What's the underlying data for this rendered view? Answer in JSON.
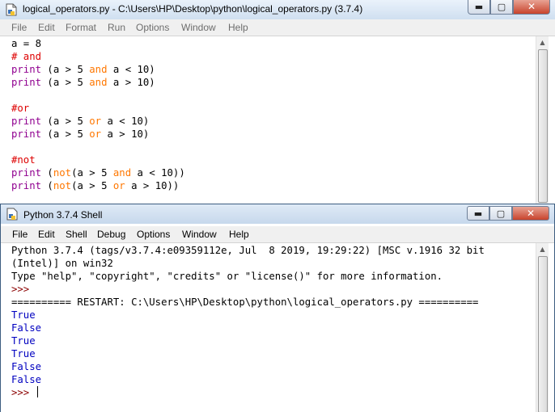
{
  "editor": {
    "title": "logical_operators.py - C:\\Users\\HP\\Desktop\\python\\logical_operators.py (3.7.4)",
    "menu": [
      "File",
      "Edit",
      "Format",
      "Run",
      "Options",
      "Window",
      "Help"
    ],
    "lines": [
      [
        {
          "t": "a = 8",
          "c": ""
        }
      ],
      [
        {
          "t": "# and",
          "c": "cm"
        }
      ],
      [
        {
          "t": "print",
          "c": "bi"
        },
        {
          "t": " (a > 5 ",
          "c": ""
        },
        {
          "t": "and",
          "c": "kw"
        },
        {
          "t": " a < 10)",
          "c": ""
        }
      ],
      [
        {
          "t": "print",
          "c": "bi"
        },
        {
          "t": " (a > 5 ",
          "c": ""
        },
        {
          "t": "and",
          "c": "kw"
        },
        {
          "t": " a > 10)",
          "c": ""
        }
      ],
      [],
      [
        {
          "t": "#or",
          "c": "cm"
        }
      ],
      [
        {
          "t": "print",
          "c": "bi"
        },
        {
          "t": " (a > 5 ",
          "c": ""
        },
        {
          "t": "or",
          "c": "kw"
        },
        {
          "t": " a < 10)",
          "c": ""
        }
      ],
      [
        {
          "t": "print",
          "c": "bi"
        },
        {
          "t": " (a > 5 ",
          "c": ""
        },
        {
          "t": "or",
          "c": "kw"
        },
        {
          "t": " a > 10)",
          "c": ""
        }
      ],
      [],
      [
        {
          "t": "#not",
          "c": "cm"
        }
      ],
      [
        {
          "t": "print",
          "c": "bi"
        },
        {
          "t": " (",
          "c": ""
        },
        {
          "t": "not",
          "c": "kw"
        },
        {
          "t": "(a > 5 ",
          "c": ""
        },
        {
          "t": "and",
          "c": "kw"
        },
        {
          "t": " a < 10))",
          "c": ""
        }
      ],
      [
        {
          "t": "print",
          "c": "bi"
        },
        {
          "t": " (",
          "c": ""
        },
        {
          "t": "not",
          "c": "kw"
        },
        {
          "t": "(a > 5 ",
          "c": ""
        },
        {
          "t": "or",
          "c": "kw"
        },
        {
          "t": " a > 10))",
          "c": ""
        }
      ]
    ]
  },
  "shell": {
    "title": "Python 3.7.4 Shell",
    "menu": [
      "File",
      "Edit",
      "Shell",
      "Debug",
      "Options",
      "Window",
      "Help"
    ],
    "lines": [
      [
        {
          "t": "Python 3.7.4 (tags/v3.7.4:e09359112e, Jul  8 2019, 19:29:22) [MSC v.1916 32 bit",
          "c": ""
        }
      ],
      [
        {
          "t": "(Intel)] on win32",
          "c": ""
        }
      ],
      [
        {
          "t": "Type \"help\", \"copyright\", \"credits\" or \"license()\" for more information.",
          "c": ""
        }
      ],
      [
        {
          "t": ">>> ",
          "c": "prompt"
        }
      ],
      [
        {
          "t": "========== RESTART: C:\\Users\\HP\\Desktop\\python\\logical_operators.py ==========",
          "c": ""
        }
      ],
      [
        {
          "t": "True",
          "c": "out"
        }
      ],
      [
        {
          "t": "False",
          "c": "out"
        }
      ],
      [
        {
          "t": "True",
          "c": "out"
        }
      ],
      [
        {
          "t": "True",
          "c": "out"
        }
      ],
      [
        {
          "t": "False",
          "c": "out"
        }
      ],
      [
        {
          "t": "False",
          "c": "out"
        }
      ]
    ],
    "prompt": ">>> "
  },
  "controls": {
    "minimize": "▬",
    "maximize": "▢",
    "close": "✕"
  },
  "icons": {
    "editor": "idle-file-icon",
    "shell": "python-shell-icon"
  }
}
